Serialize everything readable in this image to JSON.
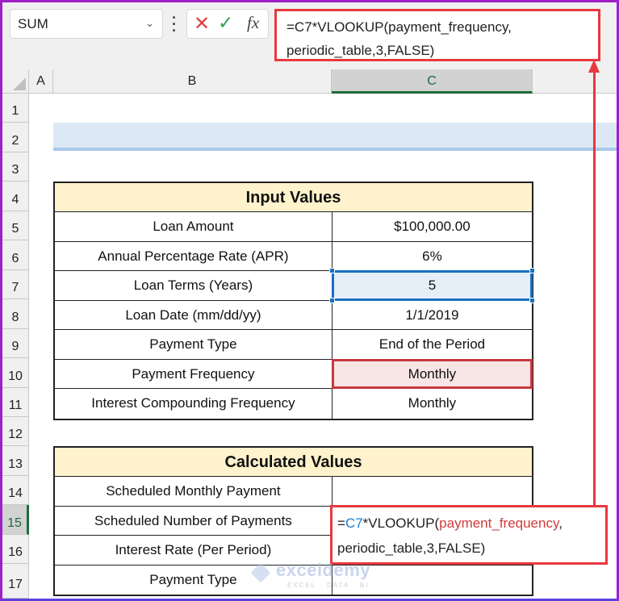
{
  "toolbar": {
    "name_box": "SUM",
    "name_box_icon": "chevron-down-icon",
    "more_icon": "vertical-ellipsis-icon",
    "cancel_icon": "✕",
    "enter_icon": "✓",
    "function_icon": "fx",
    "formula_line1": "=C7*VLOOKUP(payment_frequency,",
    "formula_line2": "periodic_table,3,FALSE)"
  },
  "columns": [
    "A",
    "B",
    "C"
  ],
  "rows": [
    "1",
    "2",
    "3",
    "4",
    "5",
    "6",
    "7",
    "8",
    "9",
    "10",
    "11",
    "12",
    "13",
    "14",
    "15",
    "16",
    "17"
  ],
  "active_row": "15",
  "active_column": "C",
  "input_table": {
    "title": "Input Values",
    "rows": [
      {
        "label": "Loan Amount",
        "value": "$100,000.00"
      },
      {
        "label": "Annual Percentage Rate (APR)",
        "value": "6%"
      },
      {
        "label": "Loan Terms (Years)",
        "value": "5"
      },
      {
        "label": "Loan Date (mm/dd/yy)",
        "value": "1/1/2019"
      },
      {
        "label": "Payment Type",
        "value": "End of the Period"
      },
      {
        "label": "Payment Frequency",
        "value": "Monthly"
      },
      {
        "label": "Interest Compounding Frequency",
        "value": "Monthly"
      }
    ]
  },
  "calc_table": {
    "title": "Calculated Values",
    "rows": [
      {
        "label": "Scheduled Monthly Payment",
        "value": ""
      },
      {
        "label": "Scheduled Number of Payments",
        "value": ""
      },
      {
        "label": "Interest Rate (Per Period)",
        "value": ""
      },
      {
        "label": "Payment Type",
        "value": ""
      }
    ]
  },
  "cell_formula": {
    "eq": "=",
    "ref": "C7",
    "op": "*VLOOKUP(",
    "name": "payment_frequency",
    "comma": ",",
    "line2": "periodic_table,3,FALSE)"
  },
  "watermark": {
    "text": "exceldemy",
    "sub": "EXCEL · DATA · BI"
  },
  "colors": {
    "highlight_red": "#e8383d",
    "selection_blue": "#1a6fc0",
    "reference_red": "#c83a40",
    "header_fill": "#fff2cc",
    "active_green": "#1e6b3a"
  }
}
